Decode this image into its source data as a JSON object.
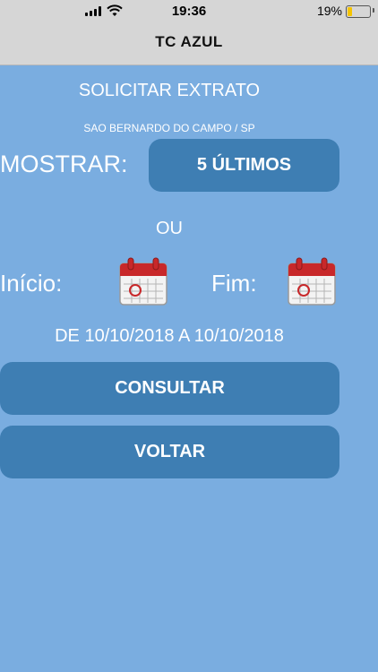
{
  "status": {
    "time": "19:36",
    "battery_percent": "19%",
    "battery_level": 0.19
  },
  "nav": {
    "title": "TC AZUL"
  },
  "main": {
    "title": "SOLICITAR EXTRATO",
    "location": "SAO BERNARDO DO CAMPO / SP",
    "mostrar_label": "MOSTRAR:",
    "ultimos_button": "5 ÚLTIMOS",
    "ou": "OU",
    "inicio_label": "Início:",
    "fim_label": "Fim:",
    "range_text": "DE 10/10/2018 A 10/10/2018",
    "consultar_button": "CONSULTAR",
    "voltar_button": "VOLTAR"
  },
  "icons": {
    "calendar": "calendar-icon",
    "wifi": "wifi-icon",
    "signal": "cellular-signal-icon",
    "battery": "battery-icon"
  },
  "colors": {
    "background": "#7aade0",
    "button": "#3e7eb3",
    "bar": "#d6d6d6",
    "calendar_red": "#c8282a",
    "battery_fill": "#f5c400"
  }
}
